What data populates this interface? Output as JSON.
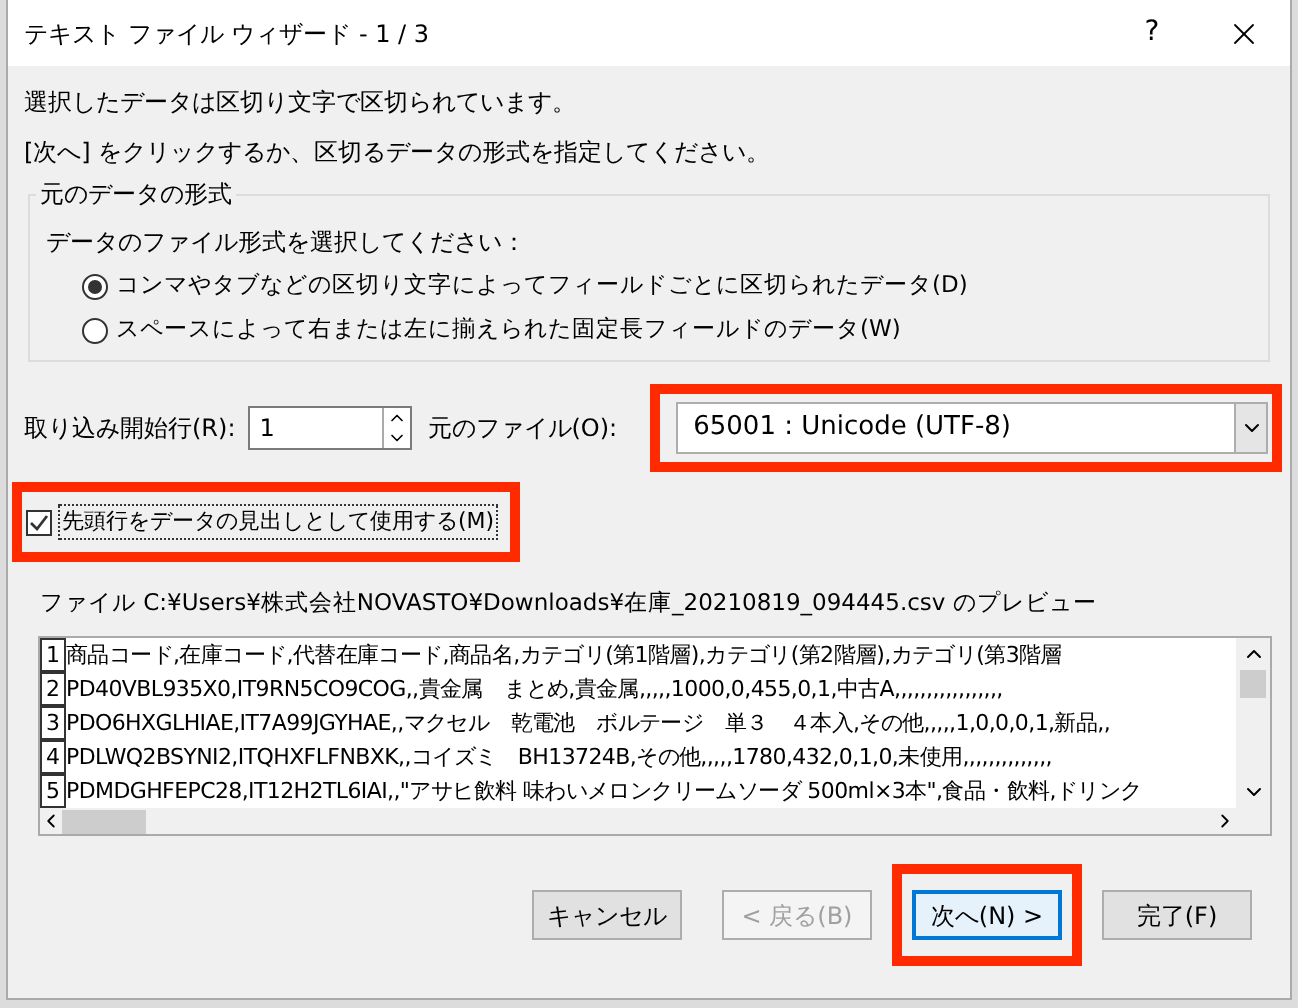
{
  "window": {
    "title": "テキスト ファイル ウィザード - 1 / 3",
    "help": "?"
  },
  "messages": [
    "選択したデータは区切り文字で区切られています。",
    "[次へ] をクリックするか、区切るデータの形式を指定してください。"
  ],
  "format_group": {
    "title": "元のデータの形式",
    "prompt": "データのファイル形式を選択してください：",
    "options": [
      {
        "label": "コンマやタブなどの区切り文字によってフィールドごとに区切られたデータ(D)",
        "selected": true
      },
      {
        "label": "スペースによって右または左に揃えられた固定長フィールドのデータ(W)",
        "selected": false
      }
    ]
  },
  "start_row": {
    "label": "取り込み開始行(R):",
    "value": "1"
  },
  "file_origin": {
    "label": "元のファイル(O):",
    "value": "65001 : Unicode (UTF-8)",
    "highlighted": true
  },
  "header_checkbox": {
    "label": "先頭行をデータの見出しとして使用する(M)",
    "checked": true,
    "highlighted": true
  },
  "preview": {
    "caption": "ファイル C:¥Users¥株式会社NOVASTO¥Downloads¥在庫_20210819_094445.csv のプレビュー",
    "rows": [
      {
        "number": "1",
        "text": "商品コード,在庫コード,代替在庫コード,商品名,カテゴリ(第1階層),カテゴリ(第2階層),カテゴリ(第3階層"
      },
      {
        "number": "2",
        "text": "PD40VBL935X0,IT9RN5CO9COG,,貴金属　まとめ,貴金属,,,,,1000,0,455,0,1,中古A,,,,,,,,,,,,,,,,,"
      },
      {
        "number": "3",
        "text": "PDO6HXGLHIAE,IT7A99JGYHAE,,マクセル　乾電池　ボルテージ　単３　４本入,その他,,,,,1,0,0,0,1,新品,,"
      },
      {
        "number": "4",
        "text": "PDLWQ2BSYNI2,ITQHXFLFNBXK,,コイズミ　BH13724B,その他,,,,,1780,432,0,1,0,未使用,,,,,,,,,,,,,,"
      },
      {
        "number": "5",
        "text": "PDMDGHFEPC28,IT12H2TL6IAI,,\"アサヒ飲料 味わいメロンクリームソーダ 500ml×3本\",食品・飲料,ドリンク"
      }
    ]
  },
  "buttons": [
    {
      "label": "キャンセル",
      "disabled": false,
      "default": false,
      "highlighted": false
    },
    {
      "label": "< 戻る(B)",
      "disabled": true,
      "default": false,
      "highlighted": false
    },
    {
      "label": "次へ(N) >",
      "disabled": false,
      "default": true,
      "highlighted": true
    },
    {
      "label": "完了(F)",
      "disabled": false,
      "default": false,
      "highlighted": false
    }
  ]
}
